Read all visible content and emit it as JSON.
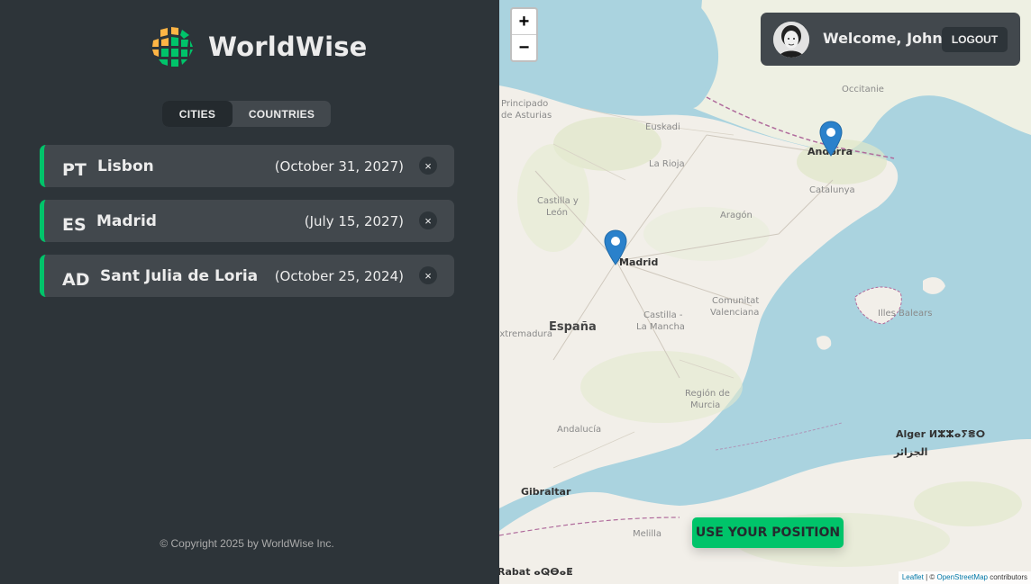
{
  "app": {
    "name": "WorldWise"
  },
  "tabs": {
    "cities": "CITIES",
    "countries": "COUNTRIES"
  },
  "cities": [
    {
      "code": "PT",
      "name": "Lisbon",
      "date": "(October 31, 2027)",
      "delete": "×"
    },
    {
      "code": "ES",
      "name": "Madrid",
      "date": "(July 15, 2027)",
      "delete": "×"
    },
    {
      "code": "AD",
      "name": "Sant Julia de Loria",
      "date": "(October 25, 2024)",
      "delete": "×"
    }
  ],
  "footer": {
    "copyright": "© Copyright 2025 by WorldWise Inc."
  },
  "map": {
    "zoom_in": "+",
    "zoom_out": "−",
    "labels": {
      "principado": "Principado",
      "asturias": "de Asturias",
      "euskadi": "Euskadi",
      "larioja": "La Rioja",
      "castilla": "Castilla y",
      "leon": "León",
      "aragon": "Aragón",
      "catalunya": "Catalunya",
      "andorra": "Andorra",
      "occitanie": "Occitanie",
      "madrid": "Madrid",
      "espana": "España",
      "extremadura": "Extremadura",
      "castillalm1": "Castilla -",
      "castillalm2": "La Mancha",
      "comunitat1": "Comunitat",
      "comunitat2": "Valenciana",
      "baleares": "Illes Balears",
      "murcia1": "Región de",
      "murcia2": "Murcia",
      "andalucia": "Andalucía",
      "gibraltar": "Gibraltar",
      "alger": "Alger ⵍⵣⵣⴰⵢⴻⵔ",
      "aljazair": "الجزائر",
      "melilla": "Melilla",
      "rabat": "Rabat ⴰⵕⴱⴰⵟ"
    },
    "attribution": {
      "leaflet": "Leaflet",
      "sep": " | © ",
      "osm": "OpenStreetMap",
      "contrib": " contributors"
    }
  },
  "user": {
    "welcome": "Welcome, John",
    "logout": "LOGOUT"
  },
  "use_position": "USE YOUR POSITION",
  "colors": {
    "accent": "#00c46a",
    "sidebar": "#2d3439",
    "card": "#42484d",
    "sea": "#aad3df",
    "pin": "#2a81cb"
  }
}
